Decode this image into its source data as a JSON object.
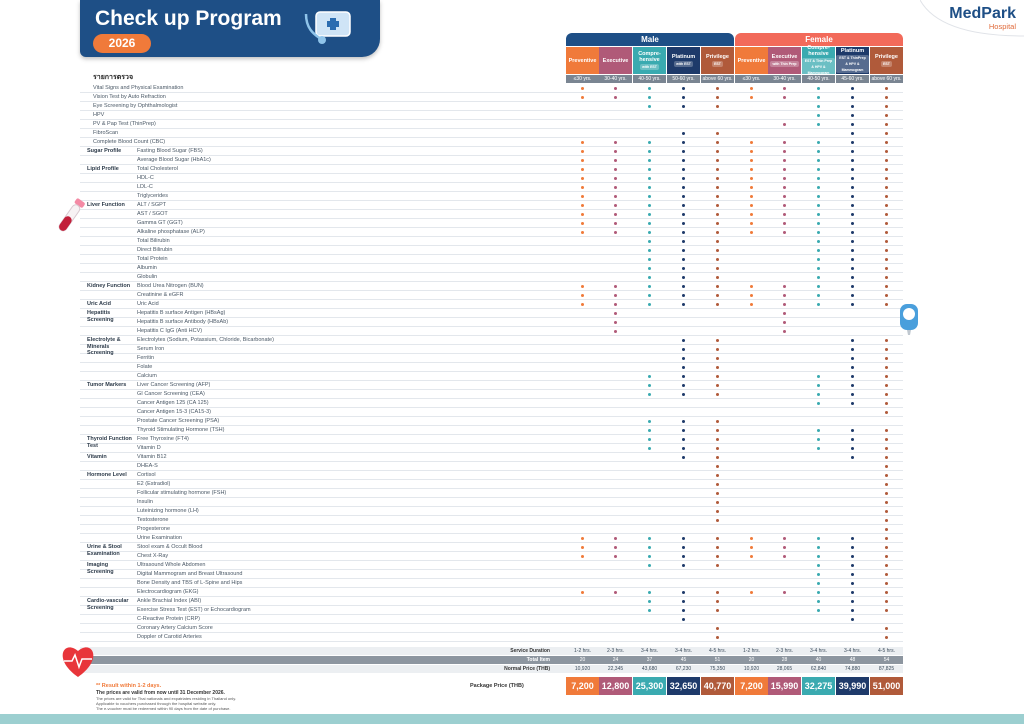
{
  "title": "Check up Program",
  "year": "2026",
  "brand": {
    "name": "MedPark",
    "sub": "Hospital"
  },
  "section_label": "รายการตรวจ",
  "genders": {
    "male": "Male",
    "female": "Female"
  },
  "packages": [
    {
      "name": "Preventive",
      "sub": "",
      "age": "≤30 yrs.",
      "color": "#f07a3a"
    },
    {
      "name": "Executive",
      "sub": "",
      "age": "30-40 yrs.",
      "color": "#b05a78"
    },
    {
      "name": "Compre-hensive",
      "sub": "with EST",
      "age": "40-50 yrs.",
      "color": "#3aaab0"
    },
    {
      "name": "Platinum",
      "sub": "with EST",
      "age": "50-60 yrs.",
      "color": "#1e3a6a"
    },
    {
      "name": "Privilege",
      "sub": "EST",
      "age": "above 60 yrs.",
      "color": "#b05a3a"
    },
    {
      "name": "Preventive",
      "sub": "",
      "age": "≤30 yrs.",
      "color": "#f07a3a"
    },
    {
      "name": "Executive",
      "sub": "with Thin Prep",
      "age": "30-40 yrs.",
      "color": "#b05a78"
    },
    {
      "name": "Compre-hensive",
      "sub": "EST & Thin Prep & HPV & Mammogram",
      "age": "40-50 yrs.",
      "color": "#3aaab0"
    },
    {
      "name": "Platinum",
      "sub": "EST & ThinPrep & HPV & Mammogram",
      "age": "45-60 yrs.",
      "color": "#1e3a6a"
    },
    {
      "name": "Privilege",
      "sub": "EST",
      "age": "above 60 yrs.",
      "color": "#b05a3a"
    }
  ],
  "categories": [
    {
      "label": "Sugar Profile",
      "row": 7
    },
    {
      "label": "Lipid Profile",
      "row": 9
    },
    {
      "label": "Liver Function",
      "row": 13
    },
    {
      "label": "Kidney Function",
      "row": 22
    },
    {
      "label": "Uric Acid",
      "row": 24
    },
    {
      "label": "Hepatitis Screening",
      "row": 25
    },
    {
      "label": "Electrolyte & Minerals Screening",
      "row": 28
    },
    {
      "label": "Tumor Markers",
      "row": 33
    },
    {
      "label": "Thyroid Function Test",
      "row": 39
    },
    {
      "label": "Vitamin",
      "row": 41
    },
    {
      "label": "Hormone Level",
      "row": 43
    },
    {
      "label": "Urine & Stool Examination",
      "row": 51
    },
    {
      "label": "Imaging Screening",
      "row": 53
    },
    {
      "label": "Cardio-vascular Screening",
      "row": 57
    }
  ],
  "rows": [
    {
      "label": "Vital Signs and Physical Examination",
      "sub": false,
      "marks": "1111111111"
    },
    {
      "label": "Vision Test by Auto Refraction",
      "sub": false,
      "marks": "1111111111"
    },
    {
      "label": "Eye Screening by Ophthalmologist",
      "sub": false,
      "marks": "0011100111"
    },
    {
      "label": "HPV",
      "sub": false,
      "marks": "0000000111"
    },
    {
      "label": "PV & Pap Test (ThinPrep)",
      "sub": false,
      "marks": "0000001111"
    },
    {
      "label": "FibroScan",
      "sub": false,
      "marks": "0001100011"
    },
    {
      "label": "Complete Blood Count (CBC)",
      "sub": false,
      "marks": "1111111111"
    },
    {
      "label": "Fasting Blood Sugar (FBS)",
      "sub": true,
      "marks": "1111111111"
    },
    {
      "label": "Average Blood Sugar (HbA1c)",
      "sub": true,
      "marks": "1111111111"
    },
    {
      "label": "Total Cholesterol",
      "sub": true,
      "marks": "1111111111"
    },
    {
      "label": "HDL-C",
      "sub": true,
      "marks": "1111111111"
    },
    {
      "label": "LDL-C",
      "sub": true,
      "marks": "1111111111"
    },
    {
      "label": "Triglycerides",
      "sub": true,
      "marks": "1111111111"
    },
    {
      "label": "ALT / SGPT",
      "sub": true,
      "marks": "1111111111"
    },
    {
      "label": "AST / SGOT",
      "sub": true,
      "marks": "1111111111"
    },
    {
      "label": "Gamma GT (GGT)",
      "sub": true,
      "marks": "1111111111"
    },
    {
      "label": "Alkaline phosphatase (ALP)",
      "sub": true,
      "marks": "1111111111"
    },
    {
      "label": "Total Bilirubin",
      "sub": true,
      "marks": "0011100111"
    },
    {
      "label": "Direct Bilirubin",
      "sub": true,
      "marks": "0011100111"
    },
    {
      "label": "Total Protein",
      "sub": true,
      "marks": "0011100111"
    },
    {
      "label": "Albumin",
      "sub": true,
      "marks": "0011100111"
    },
    {
      "label": "Globulin",
      "sub": true,
      "marks": "0011100111"
    },
    {
      "label": "Blood Urea Nitrogen (BUN)",
      "sub": true,
      "marks": "1111111111"
    },
    {
      "label": "Creatinine & eGFR",
      "sub": true,
      "marks": "1111111111"
    },
    {
      "label": "Uric Acid",
      "sub": true,
      "marks": "1111111111"
    },
    {
      "label": "Hepatitis B surface Antigen (HBsAg)",
      "sub": true,
      "marks": "0100001000"
    },
    {
      "label": "Hepatitis B surface Antibody (HBsAb)",
      "sub": true,
      "marks": "0100001000"
    },
    {
      "label": "Hepatitis C IgG (Anti HCV)",
      "sub": true,
      "marks": "0100001000"
    },
    {
      "label": "Electrolytes (Sodium, Potassium, Chloride, Bicarbonate)",
      "sub": true,
      "marks": "0001100011"
    },
    {
      "label": "Serum Iron",
      "sub": true,
      "marks": "0001100011"
    },
    {
      "label": "Ferritin",
      "sub": true,
      "marks": "0001100011"
    },
    {
      "label": "Folate",
      "sub": true,
      "marks": "0001100011"
    },
    {
      "label": "Calcium",
      "sub": true,
      "marks": "0011100111"
    },
    {
      "label": "Liver Cancer Screening (AFP)",
      "sub": true,
      "marks": "0011100111"
    },
    {
      "label": "GI Cancer Screening (CEA)",
      "sub": true,
      "marks": "0011100111"
    },
    {
      "label": "Cancer Antigen 125 (CA 125)",
      "sub": true,
      "marks": "0000000111"
    },
    {
      "label": "Cancer Antigen 15-3 (CA15-3)",
      "sub": true,
      "marks": "0000000001"
    },
    {
      "label": "Prostate Cancer Screening (PSA)",
      "sub": true,
      "marks": "0011100000"
    },
    {
      "label": "Thyroid Stimulating Hormone (TSH)",
      "sub": true,
      "marks": "0011100111"
    },
    {
      "label": "Free Thyroxine (FT4)",
      "sub": true,
      "marks": "0011100111"
    },
    {
      "label": "Vitamin D",
      "sub": true,
      "marks": "0011100111"
    },
    {
      "label": "Vitamin B12",
      "sub": true,
      "marks": "0001100011"
    },
    {
      "label": "DHEA-S",
      "sub": true,
      "marks": "0000100001"
    },
    {
      "label": "Cortisol",
      "sub": true,
      "marks": "0000100001"
    },
    {
      "label": "E2 (Estradiol)",
      "sub": true,
      "marks": "0000100001"
    },
    {
      "label": "Follicular stimulating hormone (FSH)",
      "sub": true,
      "marks": "0000100001"
    },
    {
      "label": "Insulin",
      "sub": true,
      "marks": "0000100001"
    },
    {
      "label": "Luteinizing hormone (LH)",
      "sub": true,
      "marks": "0000100001"
    },
    {
      "label": "Testosterone",
      "sub": true,
      "marks": "0000100001"
    },
    {
      "label": "Progesterone",
      "sub": true,
      "marks": "0000000001"
    },
    {
      "label": "Urine Examination",
      "sub": true,
      "marks": "1111111111"
    },
    {
      "label": "Stool exam & Occult Blood",
      "sub": true,
      "marks": "1111111111"
    },
    {
      "label": "Chest X-Ray",
      "sub": true,
      "marks": "1111111111"
    },
    {
      "label": "Ultrasound Whole Abdomen",
      "sub": true,
      "marks": "0011100111"
    },
    {
      "label": "Digital Mammogram and Breast Ultrasound",
      "sub": true,
      "marks": "0000000111"
    },
    {
      "label": "Bone Density and TBS of L-Spine and Hips",
      "sub": true,
      "marks": "0000000111"
    },
    {
      "label": "Electrocardiogram (EKG)",
      "sub": true,
      "marks": "1111111111"
    },
    {
      "label": "Ankle Brachial Index (ABI)",
      "sub": true,
      "marks": "0011100111"
    },
    {
      "label": "Exercise Stress Test (EST) or Echocardiogram",
      "sub": true,
      "marks": "0011100111"
    },
    {
      "label": "C-Reactive Protein (CRP)",
      "sub": true,
      "marks": "0001000010"
    },
    {
      "label": "Coronary Artery Calcium Score",
      "sub": true,
      "marks": "0000100001"
    },
    {
      "label": "Doppler of Carotid Arteries",
      "sub": true,
      "marks": "0000100001"
    }
  ],
  "summary": [
    {
      "label": "Service Duration",
      "values": [
        "1-2 hrs.",
        "2-3 hrs.",
        "3-4 hrs.",
        "3-4 hrs.",
        "4-5 hrs.",
        "1-2 hrs.",
        "2-3 hrs.",
        "3-4 hrs.",
        "3-4 hrs.",
        "4-5 hrs."
      ]
    },
    {
      "label": "Total Item",
      "values": [
        "20",
        "24",
        "37",
        "45",
        "51",
        "20",
        "28",
        "40",
        "48",
        "54"
      ]
    },
    {
      "label": "Normal Price (THB)",
      "values": [
        "10,920",
        "22,345",
        "43,680",
        "67,230",
        "75,350",
        "10,920",
        "28,065",
        "62,840",
        "74,880",
        "87,825"
      ]
    }
  ],
  "package_price_label": "Package Price (THB)",
  "prices": [
    "7,200",
    "12,800",
    "25,300",
    "32,650",
    "40,770",
    "7,200",
    "15,990",
    "32,275",
    "39,990",
    "51,000"
  ],
  "notes": {
    "n1": "** Result within 1-2 days.",
    "n2": "The prices are valid from now until 31 December 2026.",
    "n3": "The prices are valid for Thai nationals and expatriates residing in Thailand only.",
    "n4": "Applicable to vouchers purchased through the hospital website only.",
    "n5": "The e-voucher must be redeemed within 90 days from the date of purchase."
  }
}
